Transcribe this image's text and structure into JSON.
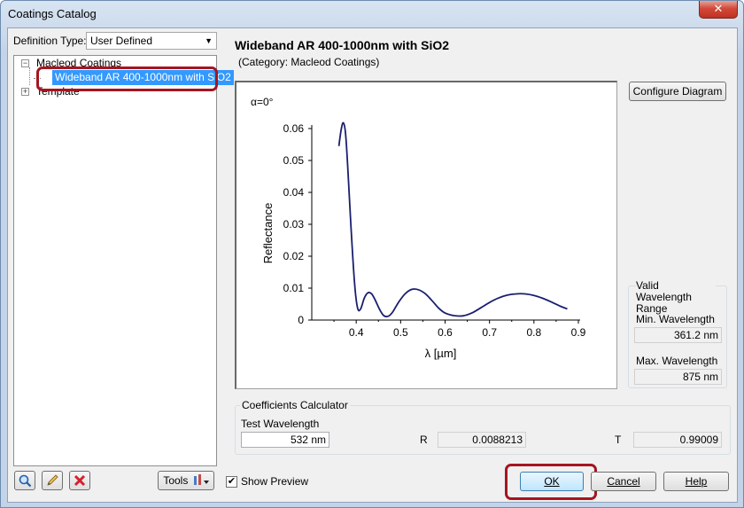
{
  "window": {
    "title": "Coatings Catalog",
    "close_symbol": "✕"
  },
  "definition_type": {
    "label": "Definition Type:",
    "value": "User Defined"
  },
  "tree": {
    "root_expanded": "Macleod Coatings",
    "selected_item": "Wideband AR 400-1000nm with SiO2",
    "root_collapsed": "Template"
  },
  "detail": {
    "title": "Wideband AR 400-1000nm with SiO2",
    "category": "(Category: Macleod Coatings)",
    "configure_button": "Configure Diagram"
  },
  "chart_data": {
    "type": "line",
    "annotation": "α=0°",
    "xlabel": "λ [µm]",
    "ylabel": "Reflectance",
    "xlim": [
      0.3,
      0.9
    ],
    "ylim": [
      0,
      0.06
    ],
    "xticks": [
      "0.4",
      "0.5",
      "0.6",
      "0.7",
      "0.8",
      "0.9"
    ],
    "yticks": [
      "0",
      "0.01",
      "0.02",
      "0.03",
      "0.04",
      "0.05",
      "0.06"
    ],
    "line_color": "#1a1f6e",
    "series": [
      {
        "points": [
          [
            0.361,
            0.0545
          ],
          [
            0.366,
            0.0595
          ],
          [
            0.371,
            0.0618
          ],
          [
            0.376,
            0.0585
          ],
          [
            0.381,
            0.048
          ],
          [
            0.388,
            0.03
          ],
          [
            0.396,
            0.012
          ],
          [
            0.403,
            0.0038
          ],
          [
            0.41,
            0.0035
          ],
          [
            0.418,
            0.0068
          ],
          [
            0.426,
            0.0085
          ],
          [
            0.434,
            0.0083
          ],
          [
            0.442,
            0.0065
          ],
          [
            0.452,
            0.0035
          ],
          [
            0.462,
            0.0014
          ],
          [
            0.472,
            0.0012
          ],
          [
            0.482,
            0.0025
          ],
          [
            0.495,
            0.0055
          ],
          [
            0.51,
            0.0082
          ],
          [
            0.525,
            0.0096
          ],
          [
            0.54,
            0.0095
          ],
          [
            0.555,
            0.0083
          ],
          [
            0.57,
            0.0062
          ],
          [
            0.585,
            0.0038
          ],
          [
            0.6,
            0.0022
          ],
          [
            0.62,
            0.0014
          ],
          [
            0.64,
            0.0013
          ],
          [
            0.66,
            0.0022
          ],
          [
            0.68,
            0.0038
          ],
          [
            0.7,
            0.0055
          ],
          [
            0.72,
            0.0069
          ],
          [
            0.74,
            0.0078
          ],
          [
            0.76,
            0.0082
          ],
          [
            0.78,
            0.0082
          ],
          [
            0.8,
            0.0077
          ],
          [
            0.82,
            0.0068
          ],
          [
            0.84,
            0.0056
          ],
          [
            0.86,
            0.0043
          ],
          [
            0.875,
            0.0035
          ]
        ]
      }
    ]
  },
  "valid_range": {
    "group_title": "Valid Wavelength Range",
    "min_label": "Min. Wavelength",
    "min_value": "361.2",
    "min_unit": "nm",
    "max_label": "Max. Wavelength",
    "max_value": "875",
    "max_unit": "nm"
  },
  "coefficients": {
    "group_title": "Coefficients Calculator",
    "test_label": "Test Wavelength",
    "test_value": "532",
    "test_unit": "nm",
    "r_label": "R",
    "r_value": "0.0088213",
    "t_label": "T",
    "t_value": "0.99009"
  },
  "footer": {
    "tools_label": "Tools",
    "show_preview_label": "Show Preview",
    "show_preview_checked": true,
    "check_symbol": "✔",
    "ok_label": "OK",
    "cancel_label": "Cancel",
    "help_label": "Help"
  },
  "icons": {
    "search": "search-icon",
    "edit": "pencil-icon",
    "delete": "delete-x-icon",
    "tools": "tools-icon",
    "close": "close-icon",
    "expand": "plus-expander-icon",
    "collapse": "minus-expander-icon"
  },
  "colors": {
    "highlight_red": "#a5151f",
    "selection_blue": "#3399ff"
  }
}
